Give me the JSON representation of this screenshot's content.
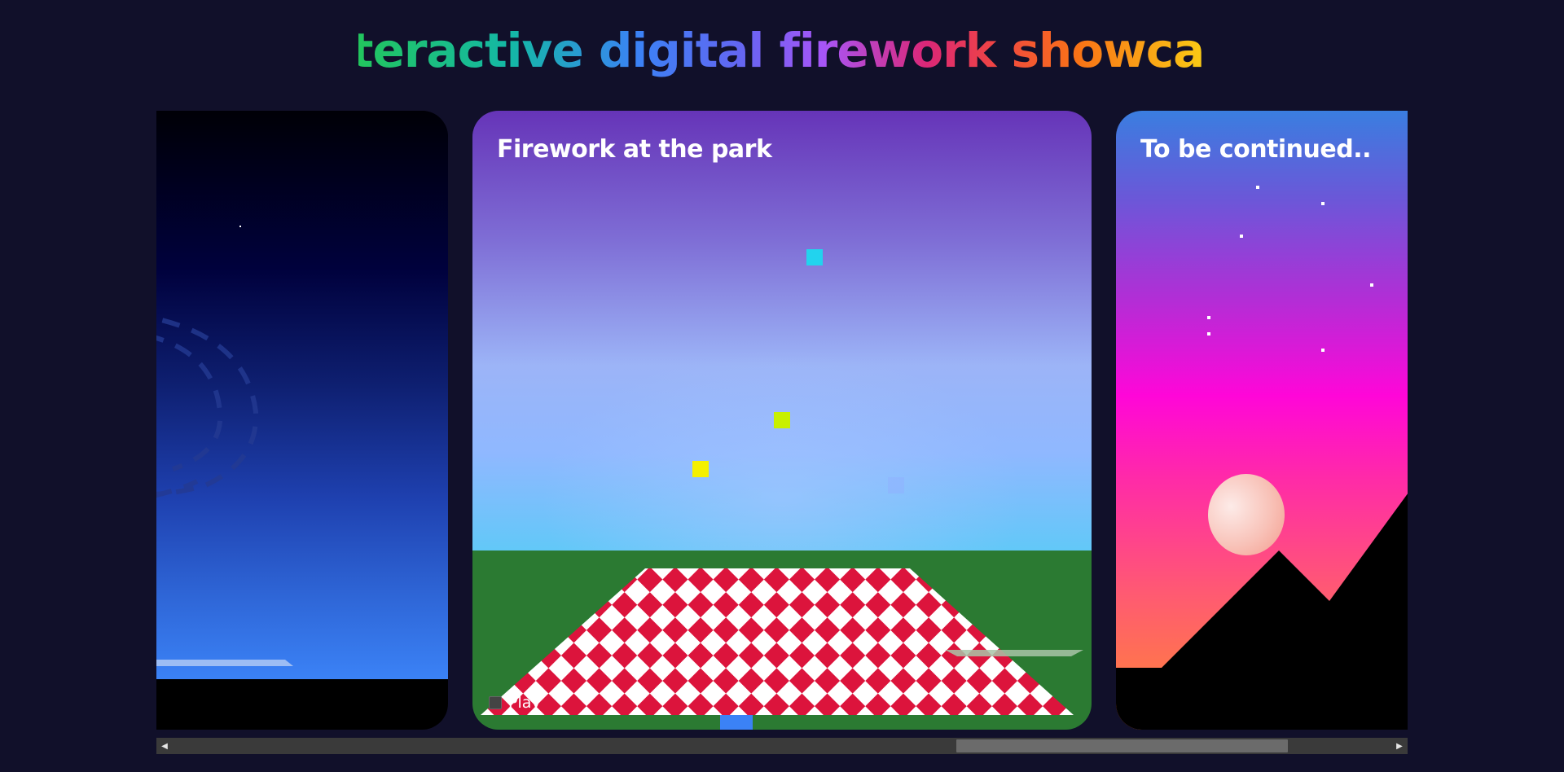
{
  "page": {
    "title": "Interactive digital firework showcase"
  },
  "cards": [
    {
      "title": ""
    },
    {
      "title": "Firework at the park",
      "play_label": "Play"
    },
    {
      "title": "To be continued.."
    }
  ],
  "colors": {
    "background": "#11102a",
    "accent": "#3b82f6",
    "grass": "#2b7a32",
    "checker_red": "#dc143c",
    "checker_white": "#ffffff"
  },
  "icons": {
    "scroll_left": "triangle-left-icon",
    "scroll_right": "triangle-right-icon"
  },
  "scrollbar": {
    "thumb_start_fraction": 0.643,
    "thumb_size_fraction": 0.272
  }
}
